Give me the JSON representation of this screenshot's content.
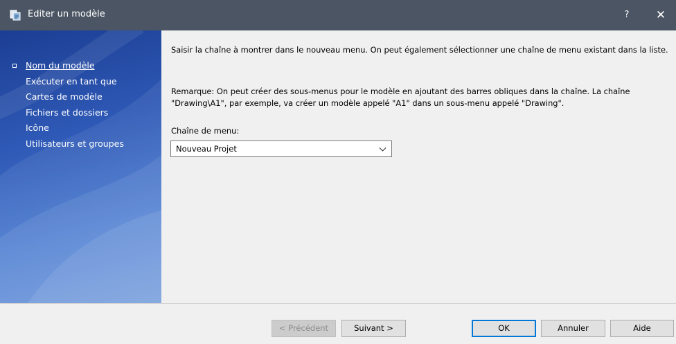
{
  "window": {
    "title": "Editer un modèle",
    "help_glyph": "?",
    "close_glyph": "✕",
    "icon": "template-edit-icon"
  },
  "sidebar": {
    "items": [
      {
        "label": "Nom du modèle",
        "active": true
      },
      {
        "label": "Exécuter en tant que",
        "active": false
      },
      {
        "label": "Cartes de modèle",
        "active": false
      },
      {
        "label": "Fichiers et dossiers",
        "active": false
      },
      {
        "label": "Icône",
        "active": false
      },
      {
        "label": "Utilisateurs et groupes",
        "active": false
      }
    ]
  },
  "main": {
    "instruction": "Saisir la chaîne à montrer dans le nouveau menu. On peut également sélectionner une chaîne de menu existant dans la liste.",
    "remark": "Remarque: On peut créer des sous-menus pour le modèle en ajoutant des barres obliques dans la chaîne. La chaîne \"Drawing\\A1\", par exemple, va créer un modèle appelé \"A1\" dans un sous-menu appelé \"Drawing\".",
    "menu_label": "Chaîne de menu:",
    "menu_value": "Nouveau Projet"
  },
  "footer": {
    "prev_label": "< Précédent",
    "next_label": "Suivant >",
    "ok_label": "OK",
    "cancel_label": "Annuler",
    "help_label": "Aide"
  },
  "colors": {
    "titlebar": "#4b5563",
    "sidebar_dark": "#1c3e93",
    "sidebar_light": "#6894da",
    "accent": "#0078d7"
  }
}
